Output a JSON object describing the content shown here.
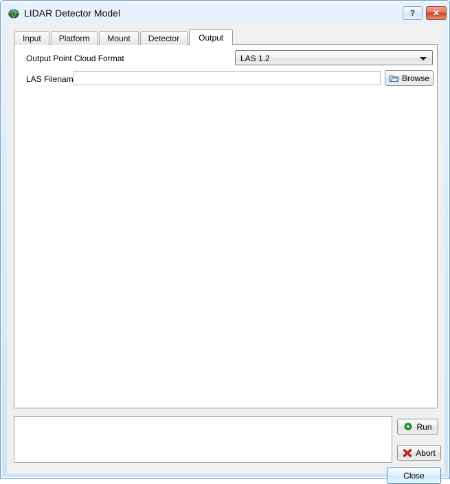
{
  "window": {
    "title": "LIDAR Detector Model",
    "icon": "app-globe-icon",
    "help_label": "?",
    "close_label": "✕",
    "border_color": "#6fa3cc",
    "close_button_color": "#c84a29"
  },
  "tabs": [
    {
      "label": "Input",
      "active": false
    },
    {
      "label": "Platform",
      "active": false
    },
    {
      "label": "Mount",
      "active": false
    },
    {
      "label": "Detector",
      "active": false
    },
    {
      "label": "Output",
      "active": true
    }
  ],
  "output_tab": {
    "format_row": {
      "label": "Output Point Cloud Format",
      "selected": "LAS 1.2",
      "options": [
        "LAS 1.2"
      ]
    },
    "filename_row": {
      "label": "LAS Filename",
      "value": "",
      "placeholder": "",
      "browse_label": "Browse",
      "browse_icon": "folder-open-icon"
    }
  },
  "log": {
    "text": ""
  },
  "actions": {
    "run_label": "Run",
    "run_icon": "green-gear-icon",
    "run_icon_color": "#22a01f",
    "abort_label": "Abort",
    "abort_icon": "red-x-icon",
    "abort_icon_color": "#d91f1f",
    "close_label": "Close"
  }
}
